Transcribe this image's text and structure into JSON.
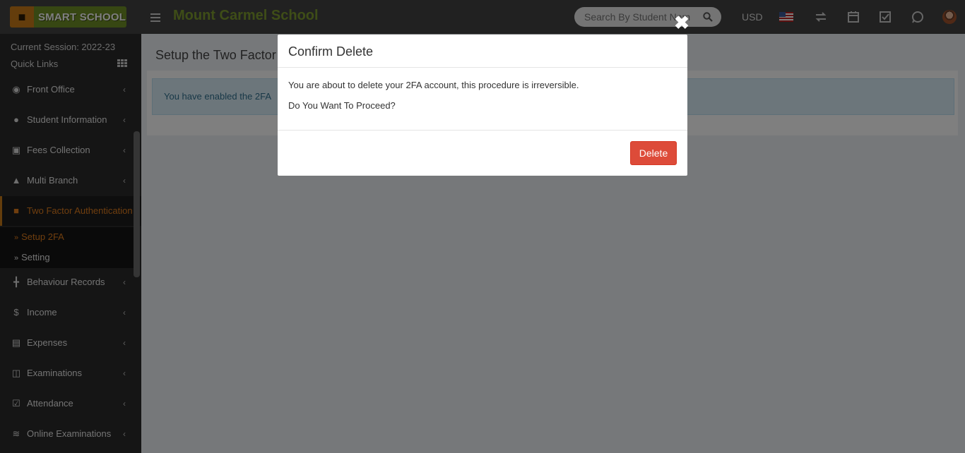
{
  "app": {
    "logo_text": "SMART SCHOOL",
    "school_name": "Mount Carmel School",
    "search_placeholder": "Search By Student Name",
    "currency": "USD"
  },
  "sidebar": {
    "session": "Current Session: 2022-23",
    "quick_links": "Quick Links",
    "items": [
      {
        "label": "Front Office",
        "icon": "front-office-icon"
      },
      {
        "label": "Student Information",
        "icon": "user-plus-icon"
      },
      {
        "label": "Fees Collection",
        "icon": "money-icon"
      },
      {
        "label": "Multi Branch",
        "icon": "sitemap-icon"
      },
      {
        "label": "Two Factor Authentication",
        "icon": "lock-icon",
        "active": true
      },
      {
        "label": "Behaviour Records",
        "icon": "signpost-icon"
      },
      {
        "label": "Income",
        "icon": "dollar-icon"
      },
      {
        "label": "Expenses",
        "icon": "credit-card-icon"
      },
      {
        "label": "Examinations",
        "icon": "map-icon"
      },
      {
        "label": "Attendance",
        "icon": "calendar-check-icon"
      },
      {
        "label": "Online Examinations",
        "icon": "rss-icon"
      }
    ],
    "submenu": [
      {
        "label": "Setup 2FA",
        "active": true
      },
      {
        "label": "Setting"
      }
    ]
  },
  "content": {
    "title": "Setup the Two Factor",
    "alert": "You have enabled the 2FA"
  },
  "modal": {
    "title": "Confirm Delete",
    "line1": "You are about to delete your 2FA account, this procedure is irreversible.",
    "line2": "Do You Want To Proceed?",
    "delete_label": "Delete",
    "close_symbol": "✖"
  },
  "colors": {
    "accent": "#e07d1d",
    "brand_green": "#7d9a2e",
    "danger": "#dd4b39"
  }
}
